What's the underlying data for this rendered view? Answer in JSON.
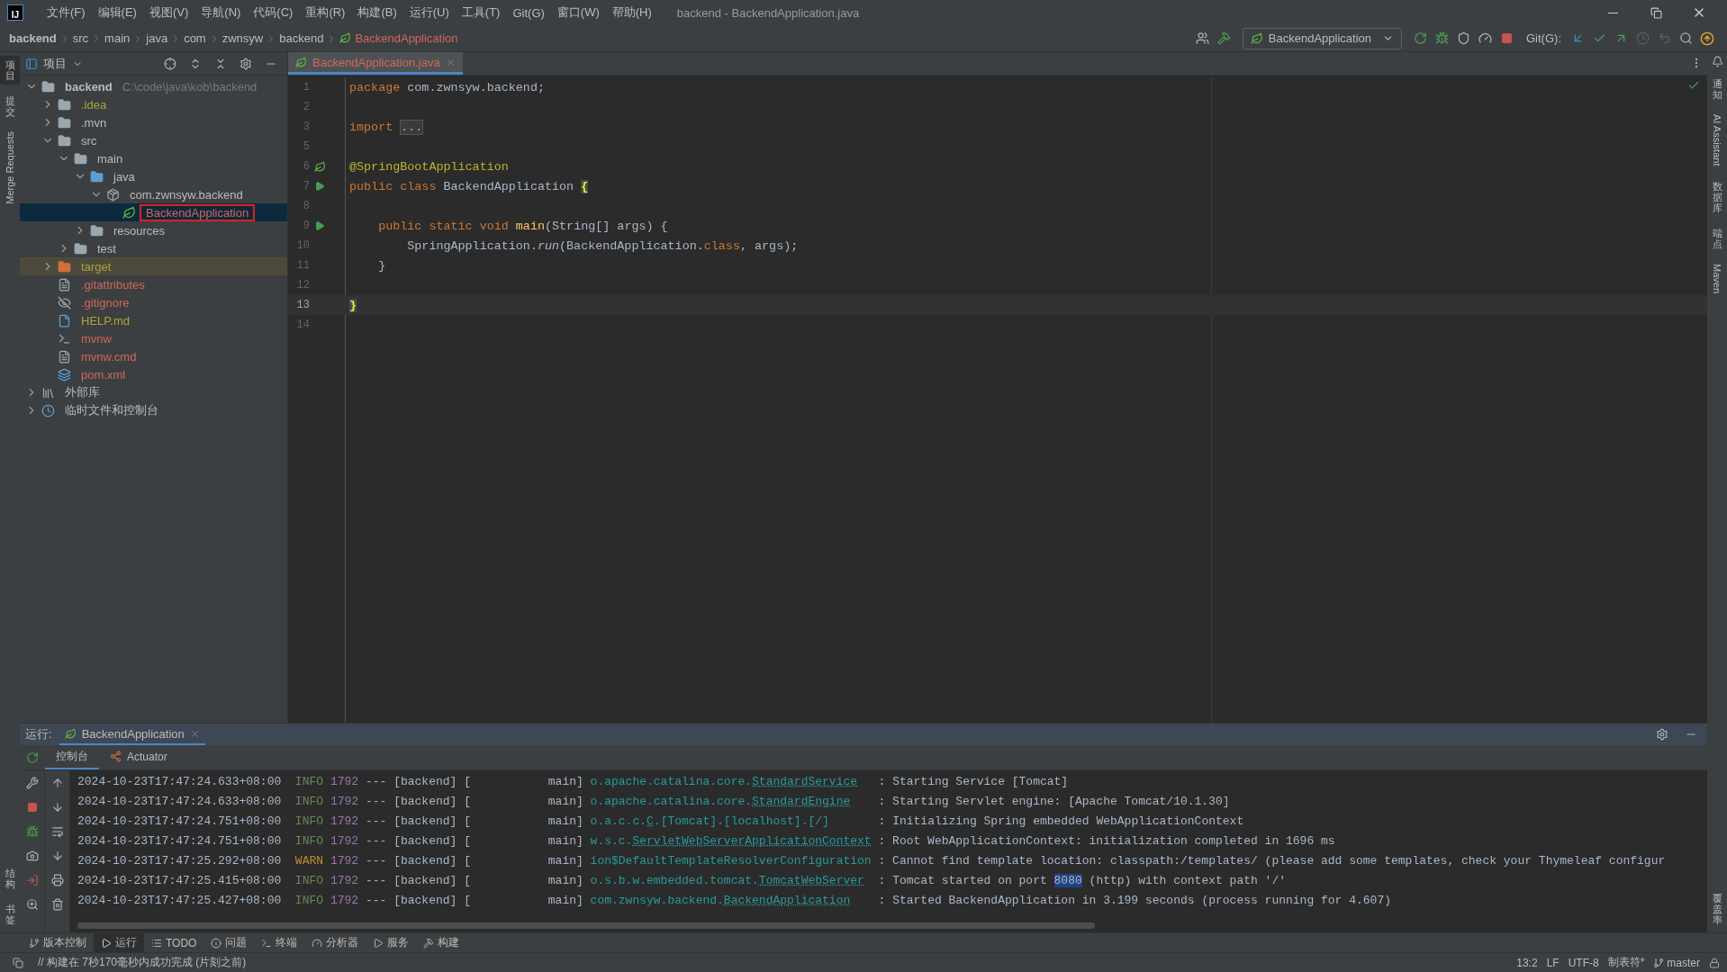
{
  "menu_bar": {
    "logo": "IJ",
    "items": [
      "文件(F)",
      "编辑(E)",
      "视图(V)",
      "导航(N)",
      "代码(C)",
      "重构(R)",
      "构建(B)",
      "运行(U)",
      "工具(T)",
      "Git(G)",
      "窗口(W)",
      "帮助(H)"
    ],
    "title": "backend - BackendApplication.java"
  },
  "breadcrumbs": [
    {
      "label": "backend",
      "kind": "module"
    },
    {
      "label": "src",
      "kind": "dir"
    },
    {
      "label": "main",
      "kind": "dir"
    },
    {
      "label": "java",
      "kind": "dir"
    },
    {
      "label": "com",
      "kind": "dir"
    },
    {
      "label": "zwnsyw",
      "kind": "dir"
    },
    {
      "label": "backend",
      "kind": "dir"
    },
    {
      "label": "BackendApplication",
      "kind": "class"
    }
  ],
  "toolbar": {
    "run_config": "BackendApplication",
    "git_label": "Git(G):"
  },
  "left_strip": {
    "top": [
      {
        "label": "项目",
        "kind": "cjk",
        "selected": true
      },
      {
        "label": "提交",
        "kind": "cjk",
        "selected": false
      },
      {
        "label": "Merge Requests",
        "kind": "latin",
        "selected": false
      }
    ],
    "bottom": [
      {
        "label": "结构",
        "kind": "cjk",
        "selected": false
      },
      {
        "label": "书签",
        "kind": "cjk",
        "selected": false
      }
    ]
  },
  "right_strip": {
    "top": [
      {
        "label": "通知",
        "kind": "cjk"
      },
      {
        "label": "AI Assistant",
        "kind": "latin"
      },
      {
        "label": "数据库",
        "kind": "cjk"
      },
      {
        "label": "端点",
        "kind": "cjk"
      },
      {
        "label": "Maven",
        "kind": "latin"
      }
    ],
    "bottom": [
      {
        "label": "覆盖率",
        "kind": "cjk"
      }
    ]
  },
  "project_panel": {
    "title": "项目",
    "tree": [
      {
        "label": "backend",
        "hint": "C:\\code\\java\\kob\\backend",
        "kind": "module",
        "expanded": true,
        "selected": false,
        "color": "#bbbbbb",
        "children": [
          {
            "label": ".idea",
            "kind": "folder",
            "expanded": false,
            "selected": false,
            "color": "#a8a835"
          },
          {
            "label": ".mvn",
            "kind": "folder",
            "expanded": false,
            "selected": false,
            "color": "#bbbbbb"
          },
          {
            "label": "src",
            "kind": "folder",
            "expanded": true,
            "selected": false,
            "color": "#bbbbbb",
            "children": [
              {
                "label": "main",
                "kind": "folder",
                "expanded": true,
                "selected": false,
                "color": "#bbbbbb",
                "children": [
                  {
                    "label": "java",
                    "kind": "source",
                    "expanded": true,
                    "selected": false,
                    "color": "#bbbbbb",
                    "children": [
                      {
                        "label": "com.zwnsyw.backend",
                        "kind": "package",
                        "expanded": true,
                        "selected": false,
                        "color": "#bbbbbb",
                        "children": [
                          {
                            "label": "BackendApplication",
                            "kind": "class",
                            "selected": true,
                            "outlined": true,
                            "color": "#d1675a"
                          }
                        ]
                      }
                    ]
                  },
                  {
                    "label": "resources",
                    "kind": "resources",
                    "expanded": false,
                    "selected": false,
                    "color": "#bbbbbb"
                  }
                ]
              },
              {
                "label": "test",
                "kind": "folder",
                "expanded": false,
                "selected": false,
                "color": "#bbbbbb"
              }
            ]
          },
          {
            "label": "target",
            "kind": "excluded",
            "expanded": false,
            "selected": false,
            "color": "#a8a835"
          },
          {
            "label": ".gitattributes",
            "kind": "file",
            "selected": false,
            "color": "#d1675a"
          },
          {
            "label": ".gitignore",
            "kind": "ignore",
            "selected": false,
            "color": "#d1675a"
          },
          {
            "label": "HELP.md",
            "kind": "markdown",
            "selected": false,
            "color": "#a8a835"
          },
          {
            "label": "mvnw",
            "kind": "script",
            "selected": false,
            "color": "#d1675a"
          },
          {
            "label": "mvnw.cmd",
            "kind": "file",
            "selected": false,
            "color": "#d1675a"
          },
          {
            "label": "pom.xml",
            "kind": "maven",
            "selected": false,
            "color": "#d1675a"
          }
        ]
      },
      {
        "label": "外部库",
        "kind": "library",
        "expanded": false,
        "selected": false,
        "color": "#bbbbbb"
      },
      {
        "label": "临时文件和控制台",
        "kind": "scratch",
        "expanded": false,
        "selected": false,
        "color": "#bbbbbb"
      }
    ]
  },
  "editor": {
    "tabs": [
      {
        "label": "BackendApplication.java",
        "selected": true
      }
    ],
    "lines": [
      {
        "number": "1",
        "current": false,
        "kind": "plain",
        "tokens": [
          {
            "kind": "keyword",
            "text": "package"
          },
          {
            "kind": "plain",
            "text": " com.zwnsyw.backend;"
          }
        ]
      },
      {
        "number": "2",
        "current": false,
        "kind": "plain"
      },
      {
        "number": "3",
        "current": false,
        "kind": "plain",
        "tokens": [
          {
            "kind": "keyword",
            "text": "import "
          },
          {
            "kind": "folded",
            "text": "..."
          }
        ]
      },
      {
        "number": "5",
        "current": false,
        "kind": "plain"
      },
      {
        "number": "6",
        "current": false,
        "kind": "bean",
        "tokens": [
          {
            "kind": "annotation",
            "text": "@SpringBootApplication"
          }
        ]
      },
      {
        "number": "7",
        "current": false,
        "kind": "run",
        "tokens": [
          {
            "kind": "keyword",
            "text": "public class "
          },
          {
            "kind": "plain",
            "text": "BackendApplication "
          },
          {
            "kind": "brace",
            "text": "{"
          }
        ]
      },
      {
        "number": "8",
        "current": false,
        "kind": "plain"
      },
      {
        "number": "9",
        "current": false,
        "kind": "run",
        "tokens": [
          {
            "kind": "keyword",
            "text": "    public static void "
          },
          {
            "kind": "method",
            "text": "main"
          },
          {
            "kind": "plain",
            "text": "(String[] args) {"
          }
        ]
      },
      {
        "number": "10",
        "current": false,
        "kind": "plain",
        "tokens": [
          {
            "kind": "plain",
            "text": "        SpringApplication."
          },
          {
            "kind": "static",
            "text": "run"
          },
          {
            "kind": "plain",
            "text": "(BackendApplication."
          },
          {
            "kind": "keyword",
            "text": "class"
          },
          {
            "kind": "plain",
            "text": ", args);"
          }
        ]
      },
      {
        "number": "11",
        "current": false,
        "kind": "plain",
        "tokens": [
          {
            "kind": "plain",
            "text": "    }"
          }
        ]
      },
      {
        "number": "12",
        "current": false,
        "kind": "plain"
      },
      {
        "number": "13",
        "current": true,
        "kind": "plain",
        "tokens": [
          {
            "kind": "brace",
            "text": "}"
          }
        ]
      },
      {
        "number": "14",
        "current": false,
        "kind": "plain"
      }
    ]
  },
  "run_panel": {
    "label": "运行:",
    "tabs": [
      {
        "label": "BackendApplication",
        "selected": true
      }
    ],
    "console_tabs": [
      {
        "label": "控制台",
        "kind": "plain",
        "selected": true
      },
      {
        "label": "Actuator",
        "kind": "actuator",
        "selected": false
      }
    ],
    "log": [
      {
        "time": "2024-10-23T17:47:24.633+08:00",
        "level": "INFO",
        "pid": "1792",
        "sep": "---",
        "app": "[backend]",
        "thread": "[           main]",
        "logger": [
          {
            "text": "o.apache.catalina.core.",
            "link": false
          },
          {
            "text": "StandardService",
            "link": true
          }
        ],
        "colon": ":",
        "message": [
          {
            "text": "Starting Service [Tomcat]",
            "selected": false
          }
        ]
      },
      {
        "time": "2024-10-23T17:47:24.633+08:00",
        "level": "INFO",
        "pid": "1792",
        "sep": "---",
        "app": "[backend]",
        "thread": "[           main]",
        "logger": [
          {
            "text": "o.apache.catalina.core.",
            "link": false
          },
          {
            "text": "StandardEngine",
            "link": true
          }
        ],
        "colon": ":",
        "message": [
          {
            "text": "Starting Servlet engine: [Apache Tomcat/10.1.30]",
            "selected": false
          }
        ]
      },
      {
        "time": "2024-10-23T17:47:24.751+08:00",
        "level": "INFO",
        "pid": "1792",
        "sep": "---",
        "app": "[backend]",
        "thread": "[           main]",
        "logger": [
          {
            "text": "o.a.c.c.",
            "link": false
          },
          {
            "text": "C",
            "link": true
          },
          {
            "text": ".[Tomcat].[localhost].[/]",
            "link": false
          }
        ],
        "colon": ":",
        "message": [
          {
            "text": "Initializing Spring embedded WebApplicationContext",
            "selected": false
          }
        ]
      },
      {
        "time": "2024-10-23T17:47:24.751+08:00",
        "level": "INFO",
        "pid": "1792",
        "sep": "---",
        "app": "[backend]",
        "thread": "[           main]",
        "logger": [
          {
            "text": "w.s.c.",
            "link": false
          },
          {
            "text": "ServletWebServerApplicationContext",
            "link": true
          }
        ],
        "colon": ":",
        "message": [
          {
            "text": "Root WebApplicationContext: initialization completed in 1696 ms",
            "selected": false
          }
        ]
      },
      {
        "time": "2024-10-23T17:47:25.292+08:00",
        "level": "WARN",
        "pid": "1792",
        "sep": "---",
        "app": "[backend]",
        "thread": "[           main]",
        "logger": [
          {
            "text": "ion$DefaultTemplateResolverConfiguration",
            "link": false
          }
        ],
        "colon": ":",
        "message": [
          {
            "text": "Cannot find template location: classpath:/templates/ (please add some templates, check your Thymeleaf configur",
            "selected": false
          }
        ]
      },
      {
        "time": "2024-10-23T17:47:25.415+08:00",
        "level": "INFO",
        "pid": "1792",
        "sep": "---",
        "app": "[backend]",
        "thread": "[           main]",
        "logger": [
          {
            "text": "o.s.b.w.embedded.tomcat.",
            "link": false
          },
          {
            "text": "TomcatWebServer",
            "link": true
          }
        ],
        "colon": ":",
        "message": [
          {
            "text": "Tomcat started on port ",
            "selected": false
          },
          {
            "text": "8080",
            "selected": true
          },
          {
            "text": " (http) with context path '/'",
            "selected": false
          }
        ]
      },
      {
        "time": "2024-10-23T17:47:25.427+08:00",
        "level": "INFO",
        "pid": "1792",
        "sep": "---",
        "app": "[backend]",
        "thread": "[           main]",
        "logger": [
          {
            "text": "com.zwnsyw.backend.",
            "link": false
          },
          {
            "text": "BackendApplication",
            "link": true
          }
        ],
        "colon": ":",
        "message": [
          {
            "text": "Started BackendApplication in 3.199 seconds (process running for 4.607)",
            "selected": false
          }
        ]
      }
    ]
  },
  "tool_tabs": [
    {
      "label": "版本控制",
      "kind": "branch",
      "selected": false
    },
    {
      "label": "运行",
      "kind": "run",
      "selected": true
    },
    {
      "label": "TODO",
      "kind": "list",
      "selected": false
    },
    {
      "label": "问题",
      "kind": "info",
      "selected": false
    },
    {
      "label": "终端",
      "kind": "terminal",
      "selected": false
    },
    {
      "label": "分析器",
      "kind": "gauge",
      "selected": false
    },
    {
      "label": "服务",
      "kind": "services",
      "selected": false
    },
    {
      "label": "构建",
      "kind": "hammer",
      "selected": false
    }
  ],
  "status_bar": {
    "message": "// 构建在 7秒170毫秒内成功完成 (片刻之前)",
    "items": [
      "13:2",
      "LF",
      "UTF-8",
      "制表符*"
    ],
    "branch": "master"
  }
}
